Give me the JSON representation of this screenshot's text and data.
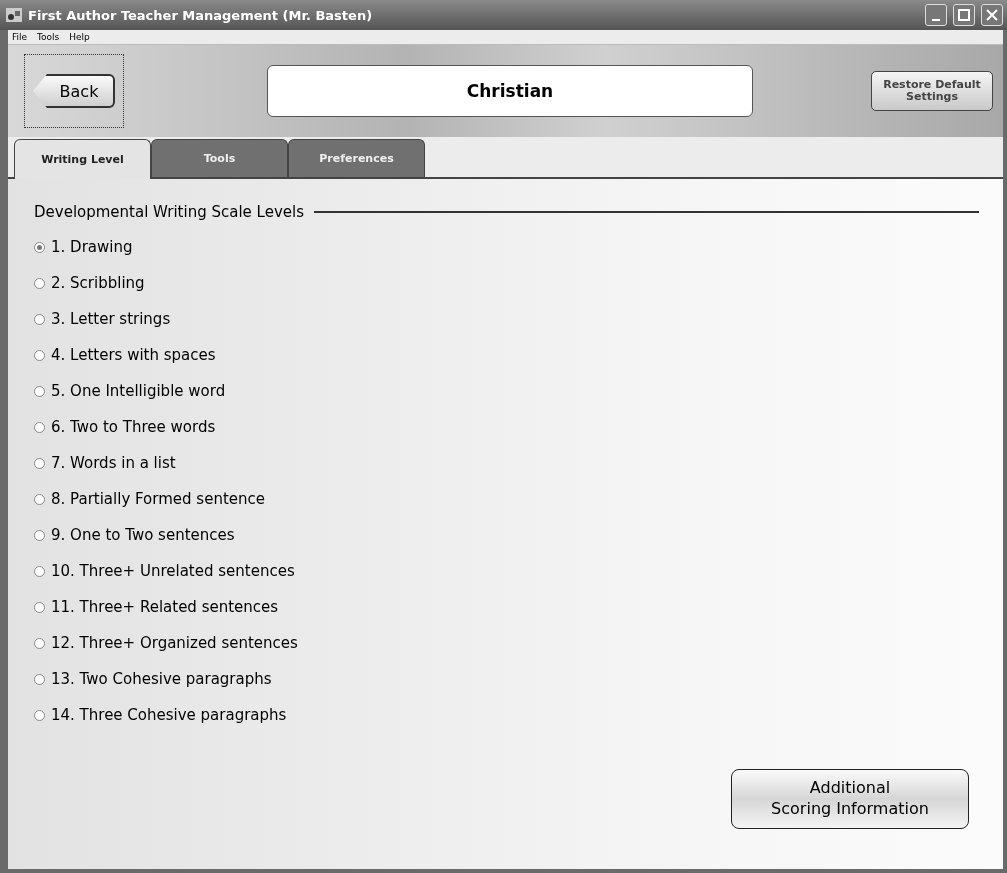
{
  "window": {
    "title": "First Author Teacher Management (Mr. Basten)"
  },
  "menu": [
    "File",
    "Tools",
    "Help"
  ],
  "header": {
    "back": "Back",
    "student": "Christian",
    "restore": "Restore Default Settings"
  },
  "tabs": [
    {
      "label": "Writing Level",
      "selected": true
    },
    {
      "label": "Tools",
      "selected": false
    },
    {
      "label": "Preferences",
      "selected": false
    }
  ],
  "section_title": "Developmental Writing Scale Levels",
  "levels": [
    {
      "label": "1. Drawing",
      "selected": true
    },
    {
      "label": "2. Scribbling",
      "selected": false
    },
    {
      "label": "3. Letter strings",
      "selected": false
    },
    {
      "label": "4. Letters with spaces",
      "selected": false
    },
    {
      "label": "5. One Intelligible word",
      "selected": false
    },
    {
      "label": "6. Two to Three words",
      "selected": false
    },
    {
      "label": "7. Words in a list",
      "selected": false
    },
    {
      "label": "8. Partially Formed sentence",
      "selected": false
    },
    {
      "label": "9. One to Two sentences",
      "selected": false
    },
    {
      "label": "10. Three+ Unrelated sentences",
      "selected": false
    },
    {
      "label": "11. Three+ Related sentences",
      "selected": false
    },
    {
      "label": "12. Three+ Organized sentences",
      "selected": false
    },
    {
      "label": "13. Two Cohesive paragraphs",
      "selected": false
    },
    {
      "label": "14. Three Cohesive paragraphs",
      "selected": false
    }
  ],
  "additional_button": [
    "Additional",
    "Scoring Information"
  ]
}
